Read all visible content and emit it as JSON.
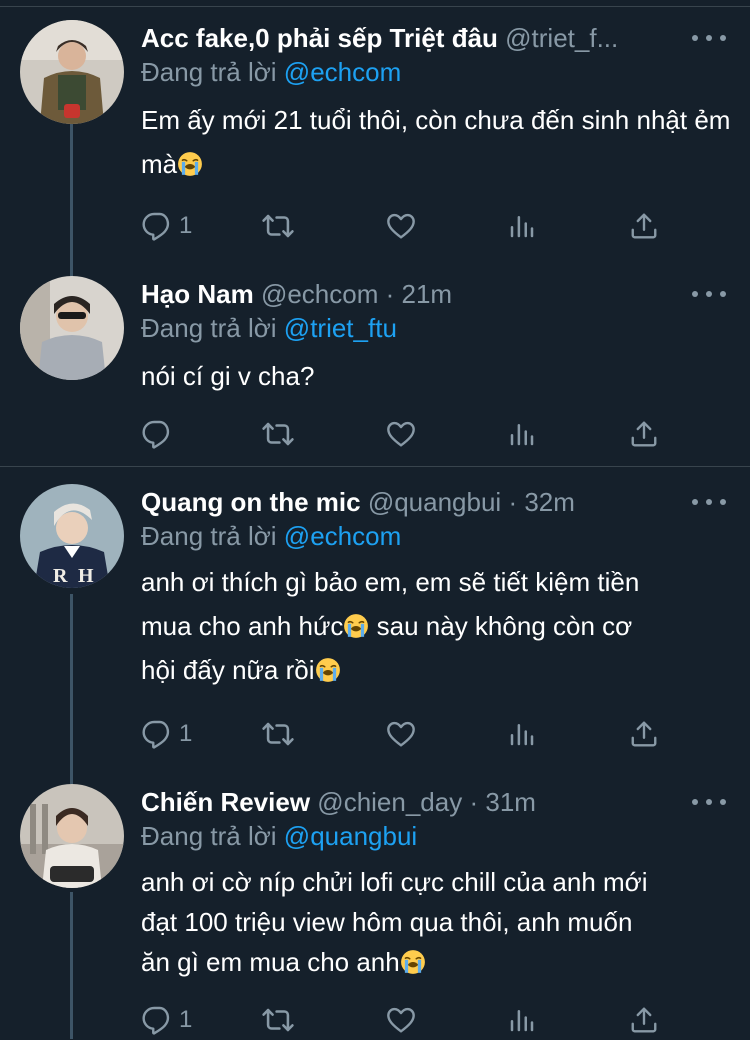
{
  "tweets": [
    {
      "name": "Acc fake,0 phải sếp Triệt đâu",
      "handle": "@triet_f...",
      "dot": "",
      "time": "",
      "reply_prefix": "Đang trả lời",
      "reply_to": "@echcom",
      "body": "Em ấy mới 21 tuổi thôi, còn chưa đến sinh nhật ẻm mà",
      "reply_count": "1",
      "retweet_count": "",
      "like_count": "",
      "emojis": [
        "loudly-crying-face"
      ]
    },
    {
      "name": "Hạo Nam",
      "handle": "@echcom",
      "dot": "·",
      "time": "21m",
      "reply_prefix": "Đang trả lời",
      "reply_to": "@triet_ftu",
      "body": "nói cí gi v cha?",
      "reply_count": "",
      "retweet_count": "",
      "like_count": ""
    },
    {
      "name": "Quang on the mic",
      "handle": "@quangbui",
      "dot": "·",
      "time": "32m",
      "reply_prefix": "Đang trả lời",
      "reply_to": "@echcom",
      "body_line1": "anh ơi thích gì bảo em, em sẽ tiết kiệm tiền",
      "body_line2a": "mua cho anh hức",
      "body_line2b": " sau này không còn cơ",
      "body_line3": "hội đấy nữa rồi",
      "reply_count": "1",
      "retweet_count": "",
      "like_count": "",
      "emojis": [
        "loudly-crying-face",
        "loudly-crying-face"
      ]
    },
    {
      "name": "Chiến Review",
      "handle": "@chien_day",
      "dot": "·",
      "time": "31m",
      "reply_prefix": "Đang trả lời",
      "reply_to": "@quangbui",
      "body_line1": "anh ơi cờ níp chửi lofi cực chill của anh mới",
      "body_line2": "đạt 100 triệu view hôm qua thôi, anh muốn",
      "body_line3": "ăn gì em mua cho anh",
      "reply_count": "1",
      "retweet_count": "",
      "like_count": "",
      "emojis": [
        "loudly-crying-face"
      ]
    }
  ],
  "icons": [
    "more-icon",
    "reply-icon",
    "retweet-icon",
    "like-icon",
    "analytics-icon",
    "share-icon"
  ],
  "colors": {
    "background": "#15202b",
    "secondary_text": "#8899a6",
    "mention": "#1da1f2",
    "divider": "#38444d"
  }
}
